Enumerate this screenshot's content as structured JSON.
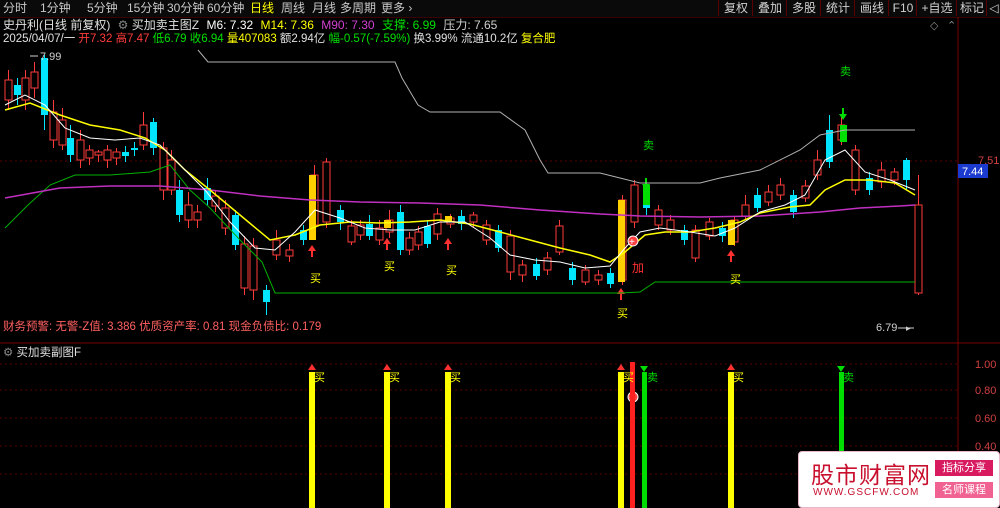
{
  "toolbar": {
    "tabs": [
      "分时",
      "1分钟",
      "5分钟",
      "15分钟",
      "30分钟",
      "60分钟",
      "日线",
      "周线",
      "月线",
      "多周期",
      "更多"
    ],
    "active_tab": "日线",
    "right_buttons": [
      "复权",
      "叠加",
      "多股",
      "统计",
      "画线",
      "F10",
      "+自选",
      "标记",
      "◁"
    ]
  },
  "header": {
    "stock_name": "史丹利(日线 前复权)",
    "indicator_name": "买加卖主图Z",
    "m6": "M6: 7.32",
    "m14": "M14: 7.36",
    "m90": "M90: 7.30",
    "support": "支撑: 6.99",
    "pressure": "压力: 7.65",
    "date": "2025/04/07/一",
    "open": "开7.32",
    "high": "高7.47",
    "low": "低6.79",
    "close": "收6.94",
    "volume": "量407083",
    "amount": "额2.94亿",
    "change": "幅-0.57(-7.59%)",
    "turnover": "换3.99%",
    "float_cap": "流通10.2亿",
    "adjust": "复合肥"
  },
  "colors": {
    "up": "#ff3c3c",
    "down": "#00e5ff",
    "m6": "#ffffff",
    "m14": "#ffff00",
    "m90": "#c030c0",
    "support": "#00c000",
    "pressure": "#c8c8c8",
    "buy": "#ffff00",
    "sell": "#00dd00"
  },
  "main_chart": {
    "price_max": "7.99",
    "price_min": "6.79",
    "axis_price": "7.51",
    "current_price": "7.44",
    "buy_label": "买",
    "sell_label": "卖",
    "add_label": "加",
    "finance_text": "财务预警: 无警-Z值: 3.386 优质资产率: 0.81 现金负债比: 0.179"
  },
  "sub_chart": {
    "title": "买加卖副图F",
    "ticks": [
      "1.00",
      "0.80",
      "0.60",
      "0.40"
    ]
  },
  "watermark": {
    "title": "股市财富网",
    "url": "WWW.GSCFW.COM",
    "tag1": "指标分享",
    "tag2": "名师课程"
  }
}
